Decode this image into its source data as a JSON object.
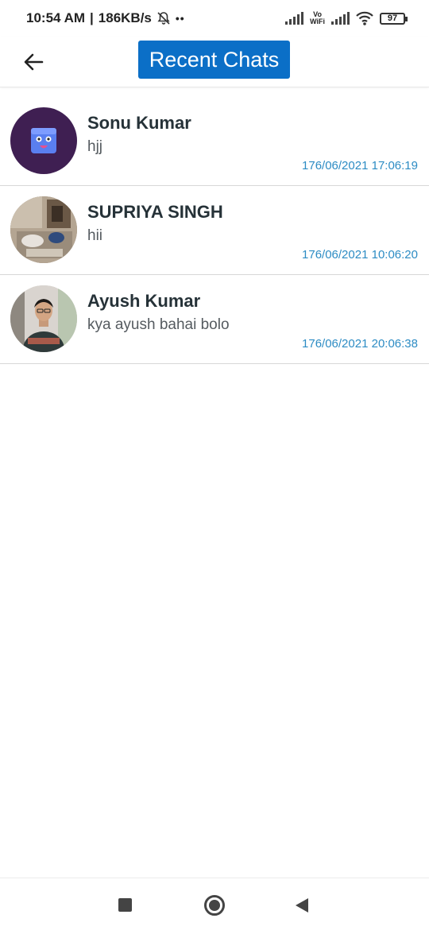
{
  "status_bar": {
    "time": "10:54 AM",
    "speed": "186KB/s",
    "vowifi_top": "Vo",
    "vowifi_bottom": "WiFi",
    "battery": "97"
  },
  "header": {
    "back_icon": "arrow-left-icon",
    "title": "Recent Chats",
    "accent_color": "#0b6fc7"
  },
  "chats": [
    {
      "name": "Sonu Kumar",
      "message": "hjj",
      "time": "176/06/2021 17:06:19"
    },
    {
      "name": "SUPRIYA SINGH",
      "message": "hii",
      "time": "176/06/2021 10:06:20"
    },
    {
      "name": "Ayush Kumar",
      "message": "kya ayush bahai bolo",
      "time": "176/06/2021 20:06:38"
    }
  ],
  "nav_bar": {
    "recents_icon": "square-icon",
    "home_icon": "circle-icon",
    "back_icon": "triangle-back-icon"
  }
}
